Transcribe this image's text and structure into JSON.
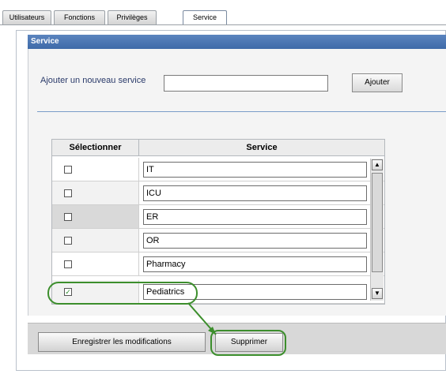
{
  "tabs": [
    {
      "label": "Utilisateurs",
      "active": false
    },
    {
      "label": "Fonctions",
      "active": false
    },
    {
      "label": "Privilèges",
      "active": false
    },
    {
      "label": "Service",
      "active": true
    }
  ],
  "panel": {
    "title": "Service",
    "add_label": "Ajouter un nouveau service",
    "add_input_value": "",
    "add_button": "Ajouter"
  },
  "table": {
    "headers": [
      "Sélectionner",
      "Service"
    ],
    "rows": [
      {
        "service": "IT",
        "checked": false
      },
      {
        "service": "ICU",
        "checked": false
      },
      {
        "service": "ER",
        "checked": false
      },
      {
        "service": "OR",
        "checked": false
      },
      {
        "service": "Pharmacy",
        "checked": false
      },
      {
        "service": "Pediatrics",
        "checked": true
      }
    ]
  },
  "footer": {
    "save_button": "Enregistrer les modifications",
    "delete_button": "Supprimer"
  },
  "colors": {
    "accent": "#3e6aa8",
    "highlight": "#3c8e2c"
  }
}
